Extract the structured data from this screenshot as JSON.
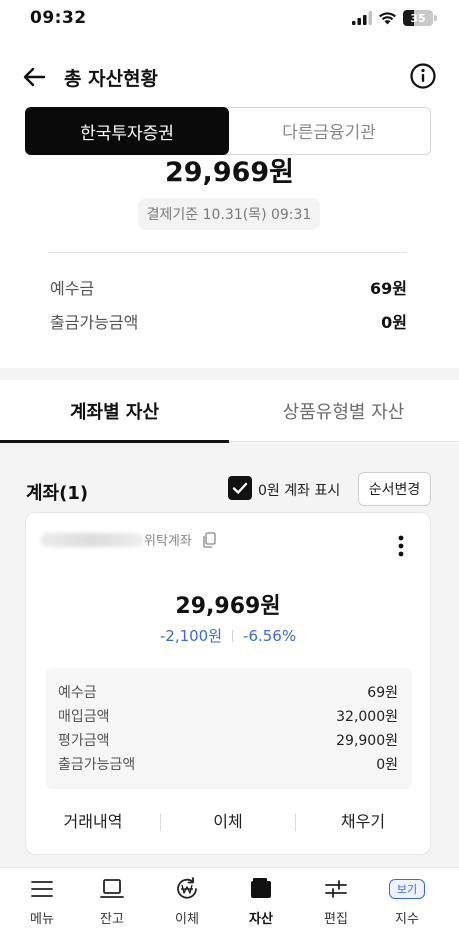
{
  "status_bar": {
    "time": "09:32",
    "battery": "35",
    "battery_level": 0.35
  },
  "header": {
    "title": "총 자산현황"
  },
  "segment": {
    "active_label": "한국투자증권",
    "inactive_label": "다른금융기관"
  },
  "summary": {
    "total_amount": "29,969원",
    "settlement_time": "결제기준 10.31(목) 09:31",
    "deposit_label": "예수금",
    "deposit_value": "69원",
    "withdrawable_label": "출금가능금액",
    "withdrawable_value": "0원"
  },
  "tabs": {
    "by_account": "계좌별 자산",
    "by_product": "상품유형별 자산"
  },
  "accounts": {
    "title": "계좌(1)",
    "show_zero_label": "0원 계좌 표시",
    "order_button": "순서변경",
    "card": {
      "account_type": "위탁계좌",
      "amount": "29,969원",
      "change_amount": "-2,100원",
      "change_rate": "-6.56%",
      "details": [
        {
          "label": "예수금",
          "value": "69원"
        },
        {
          "label": "매입금액",
          "value": "32,000원"
        },
        {
          "label": "평가금액",
          "value": "29,900원"
        },
        {
          "label": "출금가능금액",
          "value": "0원"
        }
      ],
      "actions": {
        "history": "거래내역",
        "transfer": "이체",
        "fill": "채우기"
      }
    }
  },
  "bottom_nav": {
    "menu": "메뉴",
    "balance": "잔고",
    "transfer": "이체",
    "assets": "자산",
    "edit": "편집",
    "index": "지수",
    "view_badge": "보기"
  },
  "colors": {
    "accent_blue": "#3a6bd8",
    "active_black": "#0a0a0a"
  }
}
